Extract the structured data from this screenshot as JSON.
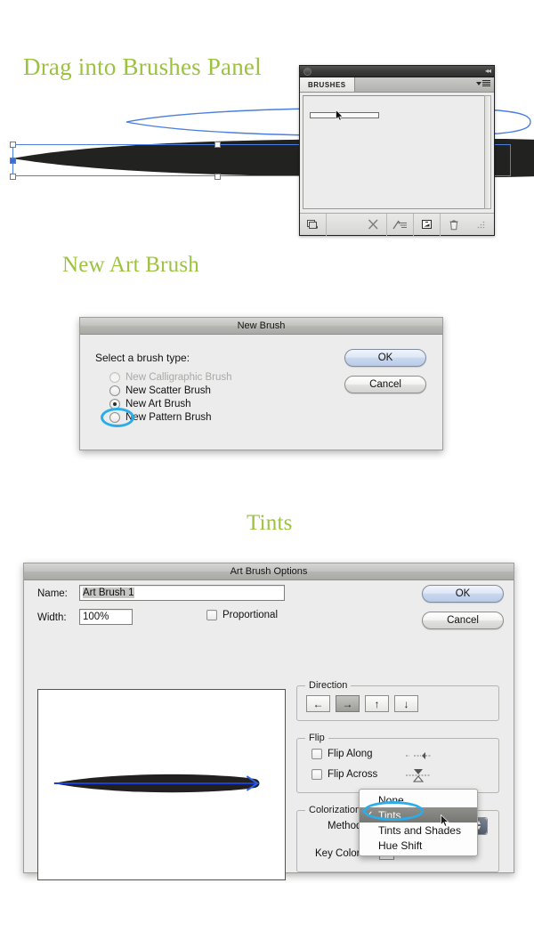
{
  "annotations": {
    "headings": [
      {
        "id": "drag",
        "text": "Drag into Brushes Panel"
      },
      {
        "id": "newart",
        "text": "New Art Brush"
      },
      {
        "id": "tints",
        "text": "Tints"
      }
    ],
    "highlight_color": "#2badea",
    "heading_color": "#9cc23f"
  },
  "brushes_panel": {
    "tab_label": "BRUSHES",
    "menu_icon": "panel-menu-icon",
    "collapse_icon": "collapse-icon",
    "footer_buttons": [
      {
        "name": "brush-libraries-menu",
        "glyph": "▥"
      },
      {
        "name": "remove-brush-stroke",
        "glyph": "✕"
      },
      {
        "name": "brush-options",
        "glyph": "╱≡"
      },
      {
        "name": "new-brush",
        "glyph": "⏏"
      },
      {
        "name": "delete-brush",
        "glyph": "Ὕ1"
      }
    ]
  },
  "new_brush_dialog": {
    "title": "New Brush",
    "prompt": "Select a brush type:",
    "options": [
      {
        "label": "New Calligraphic Brush",
        "selected": false,
        "disabled": true
      },
      {
        "label": "New Scatter Brush",
        "selected": false,
        "disabled": false
      },
      {
        "label": "New Art Brush",
        "selected": true,
        "disabled": false
      },
      {
        "label": "New Pattern Brush",
        "selected": false,
        "disabled": false
      }
    ],
    "ok_label": "OK",
    "cancel_label": "Cancel"
  },
  "art_brush_options": {
    "title": "Art Brush Options",
    "name_label": "Name:",
    "name_value": "Art Brush 1",
    "width_label": "Width:",
    "width_value": "100%",
    "proportional_label": "Proportional",
    "proportional_checked": false,
    "ok_label": "OK",
    "cancel_label": "Cancel",
    "direction": {
      "legend": "Direction",
      "buttons": [
        {
          "name": "direction-left",
          "glyph": "←",
          "active": false
        },
        {
          "name": "direction-right",
          "glyph": "→",
          "active": true
        },
        {
          "name": "direction-up",
          "glyph": "↑",
          "active": false
        },
        {
          "name": "direction-down",
          "glyph": "↓",
          "active": false
        }
      ]
    },
    "flip": {
      "legend": "Flip",
      "along_label": "Flip Along",
      "along_checked": false,
      "across_label": "Flip Across",
      "across_checked": false
    },
    "colorization": {
      "legend": "Colorization",
      "method_label": "Method:",
      "method_value": "Tints",
      "key_color_label": "Key Color:",
      "options": [
        {
          "label": "None",
          "checked": false,
          "highlighted": false
        },
        {
          "label": "Tints",
          "checked": true,
          "highlighted": true
        },
        {
          "label": "Tints and Shades",
          "checked": false,
          "highlighted": false
        },
        {
          "label": "Hue Shift",
          "checked": false,
          "highlighted": false
        }
      ]
    }
  }
}
